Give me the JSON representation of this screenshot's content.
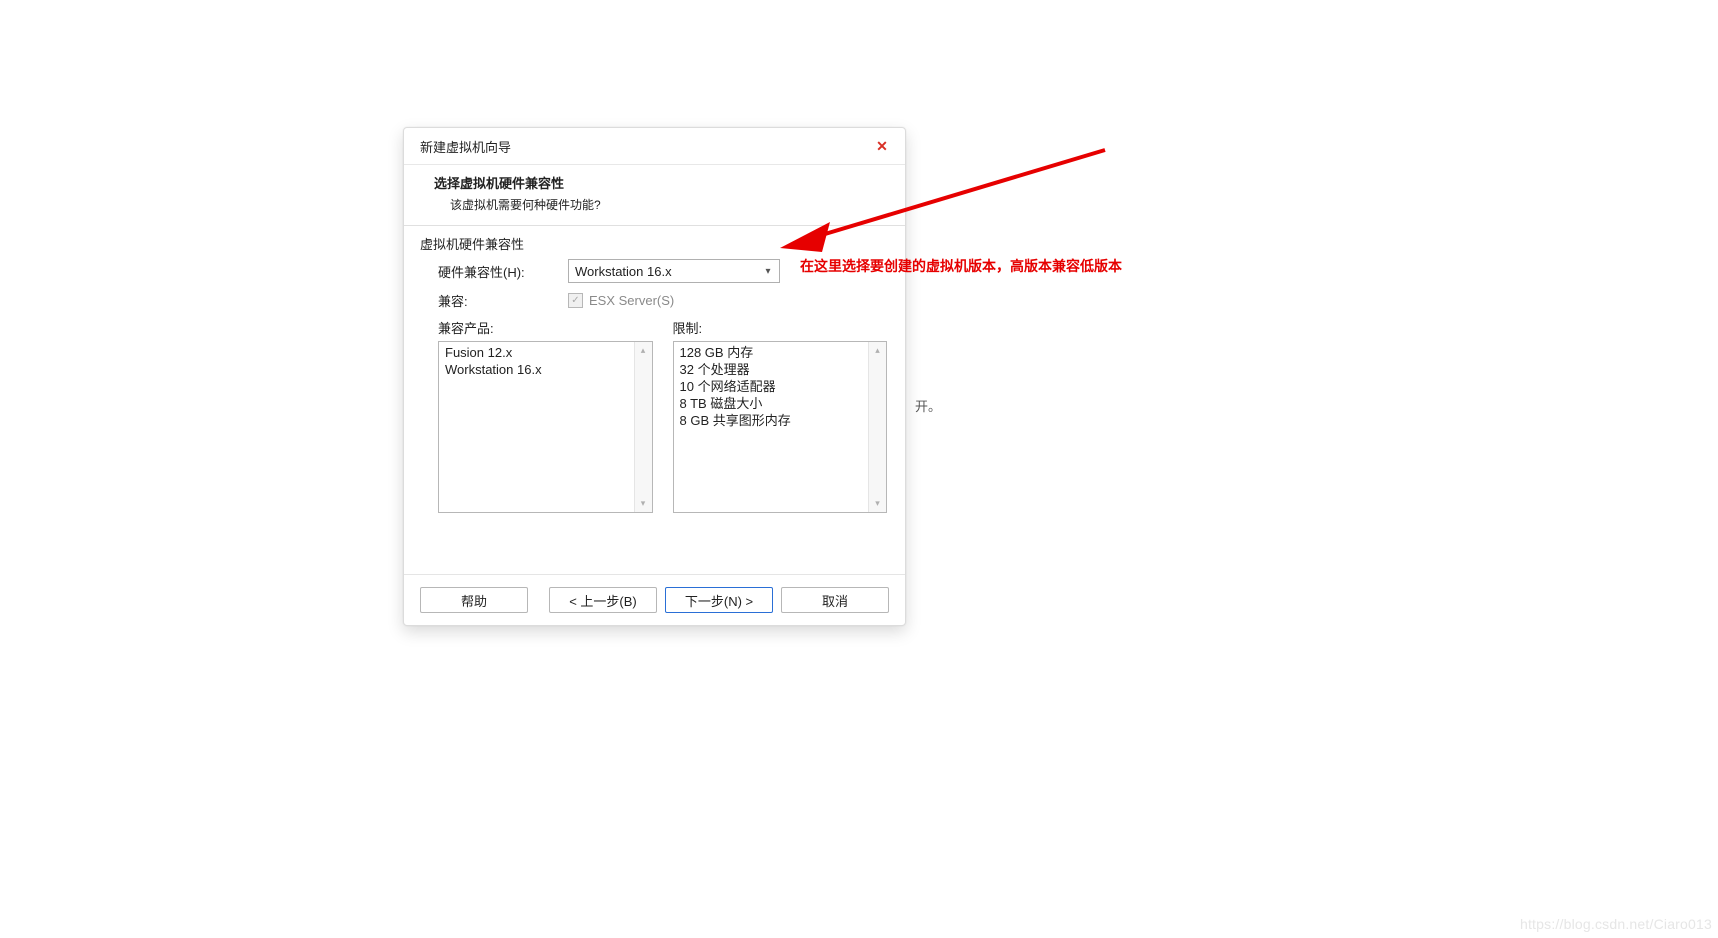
{
  "dialog": {
    "title": "新建虚拟机向导",
    "close_glyph": "✕",
    "header_title": "选择虚拟机硬件兼容性",
    "header_sub": "该虚拟机需要何种硬件功能?",
    "group_label": "虚拟机硬件兼容性",
    "hw_label": "硬件兼容性(H):",
    "hw_value": "Workstation 16.x",
    "compat_label": "兼容:",
    "checkbox_glyph": "✓",
    "checkbox_label": "ESX Server(S)",
    "products_label": "兼容产品:",
    "products_items": [
      "Fusion 12.x",
      "Workstation 16.x"
    ],
    "limits_label": "限制:",
    "limits_items": [
      "128 GB 内存",
      "32 个处理器",
      "10 个网络适配器",
      "8 TB 磁盘大小",
      "8 GB 共享图形内存"
    ],
    "scroll_up_glyph": "▴",
    "scroll_down_glyph": "▾",
    "dropdown_arrow_glyph": "▾"
  },
  "footer": {
    "help": "帮助",
    "back": "< 上一步(B)",
    "next": "下一步(N) >",
    "cancel": "取消"
  },
  "annotation": {
    "text": "在这里选择要创建的虚拟机版本，高版本兼容低版本",
    "color": "#e60000"
  },
  "background": {
    "ghost_text": "开。",
    "watermark": "https://blog.csdn.net/Ciaro013"
  }
}
